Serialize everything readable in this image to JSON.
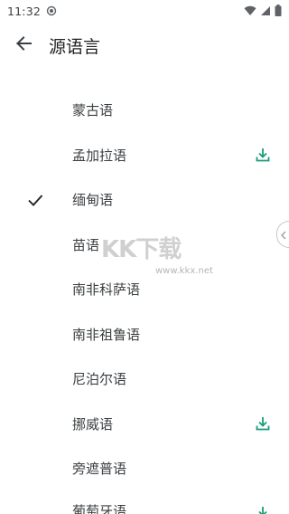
{
  "status_bar": {
    "time": "11:32",
    "icons": [
      "notification-target-icon",
      "wifi-icon",
      "signal-icon",
      "battery-icon"
    ]
  },
  "app_bar": {
    "title": "源语言",
    "back_icon": "arrow-back-icon"
  },
  "languages": [
    {
      "label": "蒙古语",
      "selected": false,
      "downloadable": false
    },
    {
      "label": "孟加拉语",
      "selected": false,
      "downloadable": true
    },
    {
      "label": "缅甸语",
      "selected": true,
      "downloadable": false
    },
    {
      "label": "苗语",
      "selected": false,
      "downloadable": false
    },
    {
      "label": "南非科萨语",
      "selected": false,
      "downloadable": false
    },
    {
      "label": "南非祖鲁语",
      "selected": false,
      "downloadable": false
    },
    {
      "label": "尼泊尔语",
      "selected": false,
      "downloadable": false
    },
    {
      "label": "挪威语",
      "selected": false,
      "downloadable": true
    },
    {
      "label": "旁遮普语",
      "selected": false,
      "downloadable": false
    },
    {
      "label": "葡萄牙语",
      "selected": false,
      "downloadable": true
    }
  ],
  "watermark": {
    "text": "KK下载",
    "url": "www.kkx.net"
  },
  "colors": {
    "accent": "#1a9b7a",
    "text": "#3c4043",
    "icon": "#5f6368"
  }
}
